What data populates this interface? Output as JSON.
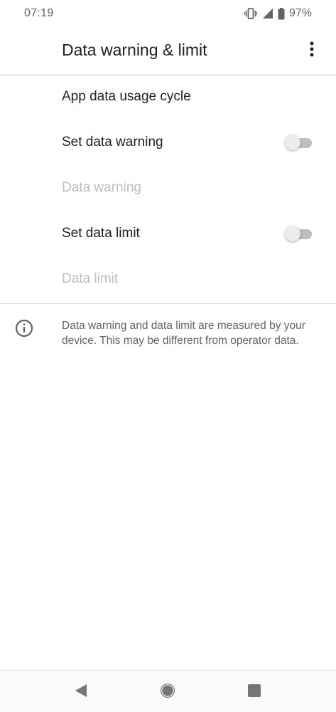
{
  "status_bar": {
    "time": "07:19",
    "battery_percent": "97%",
    "icons": [
      "vibrate-icon",
      "signal-icon",
      "battery-icon"
    ]
  },
  "app_bar": {
    "title": "Data warning & limit",
    "overflow_icon": "more-vert-icon"
  },
  "settings": {
    "app_data_usage_cycle": "App data usage cycle",
    "set_data_warning": "Set data warning",
    "set_data_warning_on": false,
    "data_warning": "Data warning",
    "set_data_limit": "Set data limit",
    "set_data_limit_on": false,
    "data_limit": "Data limit"
  },
  "info": {
    "icon": "info-icon",
    "text": "Data warning and data limit are measured by your device. This may be different from operator data."
  },
  "nav_bar": {
    "icons": [
      "back-icon",
      "home-icon",
      "recents-icon"
    ]
  },
  "colors": {
    "primary_text": "#202124",
    "secondary_text": "#5f6368",
    "disabled_text": "#bdbdbd",
    "switch_track_off": "#bdbdbd",
    "switch_thumb_off": "#ececec"
  }
}
